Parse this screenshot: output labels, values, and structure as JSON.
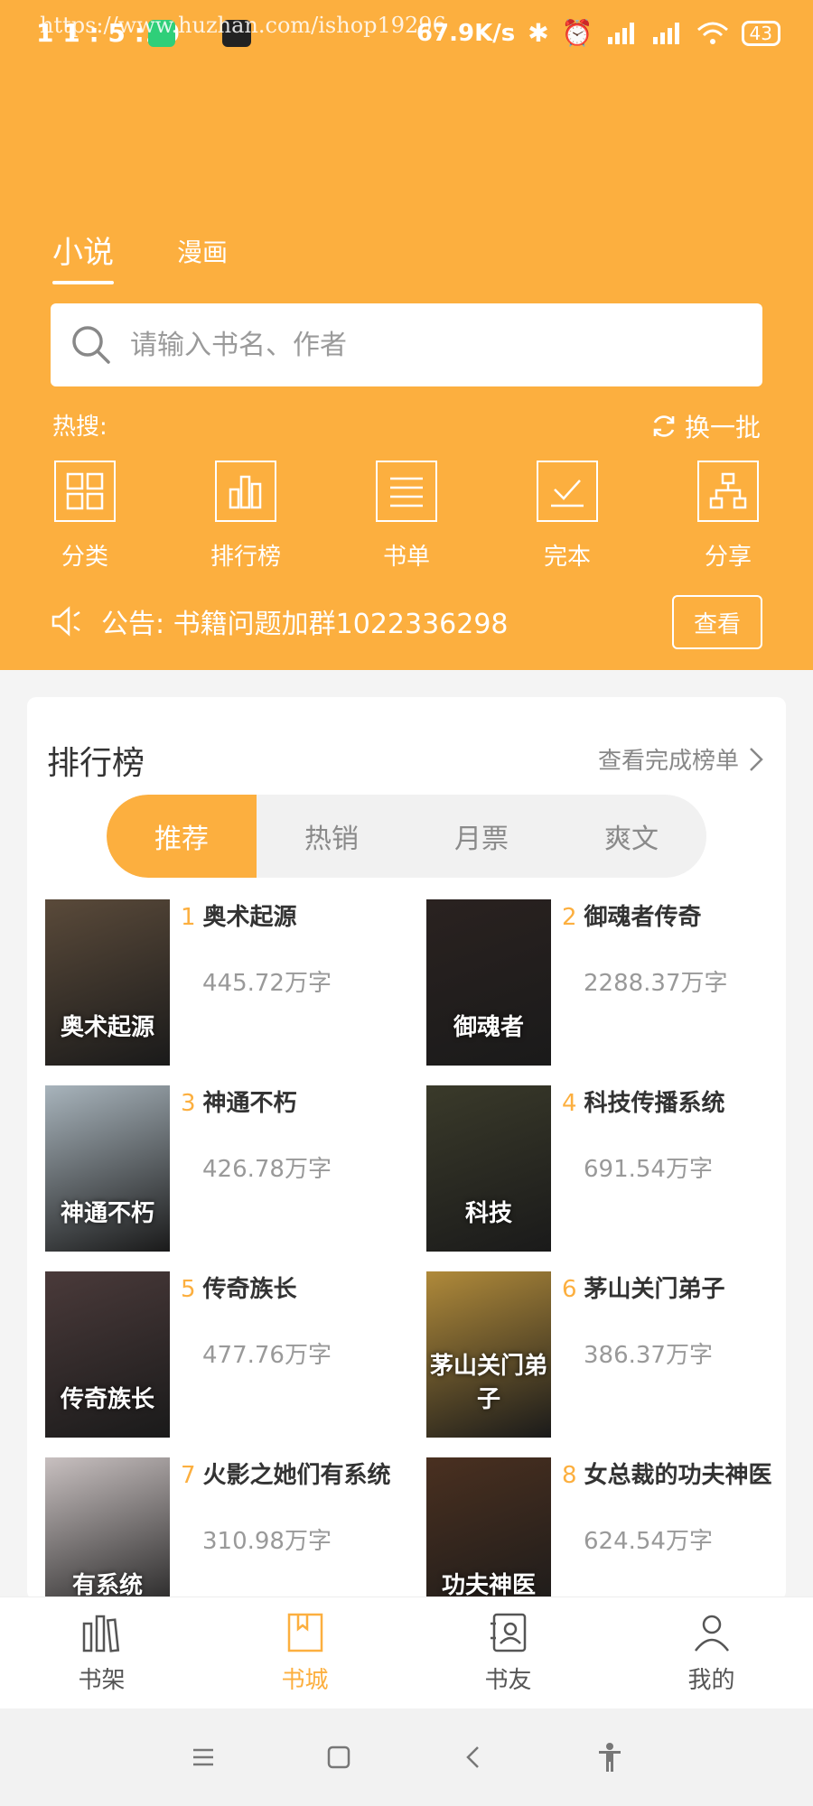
{
  "status_bar": {
    "time": "1 1 : 5 :10",
    "watermark": "https://www.huzhan.com/ishop19296",
    "network_speed": "67.9K/s",
    "battery": "43"
  },
  "top_tabs": [
    {
      "label": "小说",
      "active": true
    },
    {
      "label": "漫画",
      "active": false
    }
  ],
  "search": {
    "placeholder": "请输入书名、作者"
  },
  "hot_search": {
    "label": "热搜:",
    "refresh_label": "换一批"
  },
  "categories": [
    {
      "label": "分类",
      "icon": "grid-icon"
    },
    {
      "label": "排行榜",
      "icon": "bar-chart-icon"
    },
    {
      "label": "书单",
      "icon": "list-icon"
    },
    {
      "label": "完本",
      "icon": "checkbox-icon"
    },
    {
      "label": "分享",
      "icon": "share-tree-icon"
    }
  ],
  "notice": {
    "text": "公告: 书籍问题加群1022336298",
    "button_label": "查看"
  },
  "ranking": {
    "title": "排行榜",
    "more_label": "查看完成榜单",
    "segments": [
      {
        "label": "推荐",
        "active": true
      },
      {
        "label": "热销",
        "active": false
      },
      {
        "label": "月票",
        "active": false
      },
      {
        "label": "爽文",
        "active": false
      }
    ],
    "books": [
      {
        "rank": "1",
        "title": "奥术起源",
        "count": "445.72万字",
        "cover_text": "奥术起源",
        "cover_color": "#5a4a3a"
      },
      {
        "rank": "2",
        "title": "御魂者传奇",
        "count": "2288.37万字",
        "cover_text": "御魂者",
        "cover_color": "#2a2220"
      },
      {
        "rank": "3",
        "title": "神通不朽",
        "count": "426.78万字",
        "cover_text": "神通不朽",
        "cover_color": "#a8b4bc"
      },
      {
        "rank": "4",
        "title": "科技传播系统",
        "count": "691.54万字",
        "cover_text": "科技",
        "cover_color": "#3a3a2a"
      },
      {
        "rank": "5",
        "title": "传奇族长",
        "count": "477.76万字",
        "cover_text": "传奇族长",
        "cover_color": "#4a3a3a"
      },
      {
        "rank": "6",
        "title": "茅山关门弟子",
        "count": "386.37万字",
        "cover_text": "茅山关门弟子",
        "cover_color": "#b08a3a"
      },
      {
        "rank": "7",
        "title": "火影之她们有系统",
        "count": "310.98万字",
        "cover_text": "有系统",
        "cover_color": "#c8c0c0"
      },
      {
        "rank": "8",
        "title": "女总裁的功夫神医",
        "count": "624.54万字",
        "cover_text": "功夫神医",
        "cover_color": "#4a3020"
      }
    ]
  },
  "bottom_tabs": [
    {
      "label": "书架",
      "icon": "bookshelf-icon",
      "active": false
    },
    {
      "label": "书城",
      "icon": "bookstore-icon",
      "active": true
    },
    {
      "label": "书友",
      "icon": "contacts-icon",
      "active": false
    },
    {
      "label": "我的",
      "icon": "profile-icon",
      "active": false
    }
  ],
  "colors": {
    "accent": "#fcaf3f",
    "background": "#f4f4f4"
  }
}
